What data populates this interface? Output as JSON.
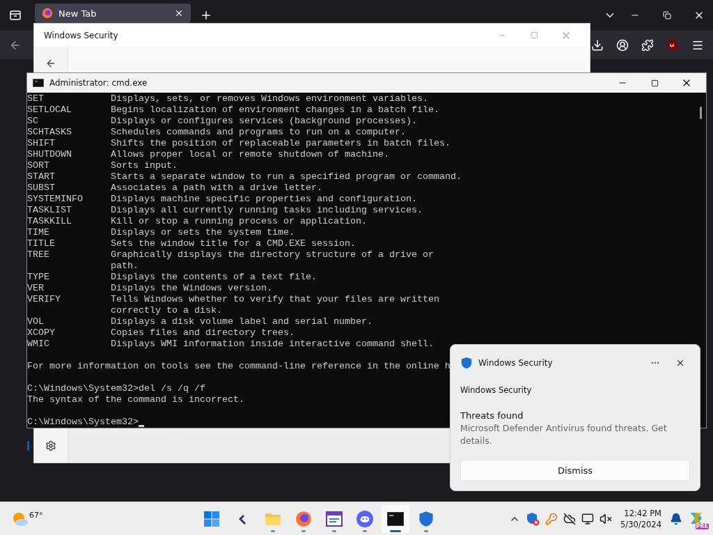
{
  "browser": {
    "tabs": [
      {
        "label": "New Tab",
        "selected": true
      }
    ]
  },
  "security_window": {
    "title": "Windows Security"
  },
  "cmd": {
    "title": "Administrator: cmd.exe",
    "lines": [
      {
        "kind": "entry",
        "command": "SET",
        "text": "Displays, sets, or removes Windows environment variables."
      },
      {
        "kind": "entry",
        "command": "SETLOCAL",
        "text": "Begins localization of environment changes in a batch file."
      },
      {
        "kind": "entry",
        "command": "SC",
        "text": "Displays or configures services (background processes)."
      },
      {
        "kind": "entry",
        "command": "SCHTASKS",
        "text": "Schedules commands and programs to run on a computer."
      },
      {
        "kind": "entry",
        "command": "SHIFT",
        "text": "Shifts the position of replaceable parameters in batch files."
      },
      {
        "kind": "entry",
        "command": "SHUTDOWN",
        "text": "Allows proper local or remote shutdown of machine."
      },
      {
        "kind": "entry",
        "command": "SORT",
        "text": "Sorts input."
      },
      {
        "kind": "entry",
        "command": "START",
        "text": "Starts a separate window to run a specified program or command."
      },
      {
        "kind": "entry",
        "command": "SUBST",
        "text": "Associates a path with a drive letter."
      },
      {
        "kind": "entry",
        "command": "SYSTEMINFO",
        "text": "Displays machine specific properties and configuration."
      },
      {
        "kind": "entry",
        "command": "TASKLIST",
        "text": "Displays all currently running tasks including services."
      },
      {
        "kind": "entry",
        "command": "TASKKILL",
        "text": "Kill or stop a running process or application."
      },
      {
        "kind": "entry",
        "command": "TIME",
        "text": "Displays or sets the system time."
      },
      {
        "kind": "entry",
        "command": "TITLE",
        "text": "Sets the window title for a CMD.EXE session."
      },
      {
        "kind": "entry",
        "command": "TREE",
        "text": "Graphically displays the directory structure of a drive or"
      },
      {
        "kind": "wrap",
        "text": "path."
      },
      {
        "kind": "entry",
        "command": "TYPE",
        "text": "Displays the contents of a text file."
      },
      {
        "kind": "entry",
        "command": "VER",
        "text": "Displays the Windows version."
      },
      {
        "kind": "entry",
        "command": "VERIFY",
        "text": "Tells Windows whether to verify that your files are written"
      },
      {
        "kind": "wrap",
        "text": "correctly to a disk."
      },
      {
        "kind": "entry",
        "command": "VOL",
        "text": "Displays a disk volume label and serial number."
      },
      {
        "kind": "entry",
        "command": "XCOPY",
        "text": "Copies files and directory trees."
      },
      {
        "kind": "entry",
        "command": "WMIC",
        "text": "Displays WMI information inside interactive command shell."
      },
      {
        "kind": "blank"
      },
      {
        "kind": "output",
        "text": "For more information on tools see the command-line reference in the online h"
      },
      {
        "kind": "blank"
      },
      {
        "kind": "output",
        "text": "C:\\Windows\\System32>del /s /q /f"
      },
      {
        "kind": "output",
        "text": "The syntax of the command is incorrect."
      },
      {
        "kind": "blank"
      },
      {
        "kind": "prompt",
        "text": "C:\\Windows\\System32>"
      }
    ]
  },
  "notification": {
    "app": "Windows Security",
    "source": "Windows Security",
    "title": "Threats found",
    "body": "Microsoft Defender Antivirus found threats. Get details.",
    "button": "Dismiss"
  },
  "taskbar": {
    "weather": "67°",
    "apps": [
      {
        "kind": "start",
        "running": false,
        "selected": false
      },
      {
        "kind": "tool",
        "running": false,
        "selected": false
      },
      {
        "kind": "folder",
        "running": true,
        "selected": false
      },
      {
        "kind": "firefox",
        "running": true,
        "selected": false
      },
      {
        "kind": "window",
        "running": true,
        "selected": false
      },
      {
        "kind": "chat",
        "running": true,
        "selected": false
      },
      {
        "kind": "terminal",
        "running": true,
        "selected": true
      },
      {
        "kind": "shield",
        "running": true,
        "selected": false
      }
    ],
    "time": "12:42 PM",
    "date": "5/30/2024",
    "copilot_badge": "PRE"
  }
}
